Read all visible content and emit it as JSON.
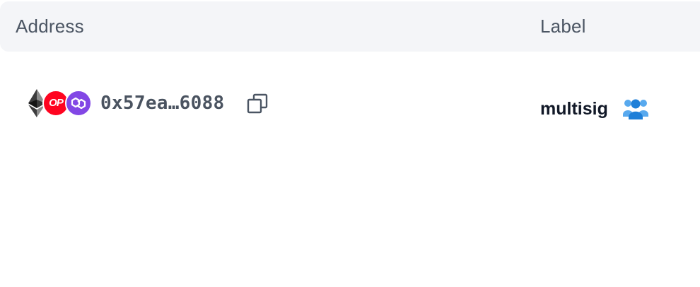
{
  "header": {
    "address_label": "Address",
    "label_label": "Label"
  },
  "rows": [
    {
      "chains": [
        {
          "name": "ethereum-icon",
          "color": "#2b2b2b"
        },
        {
          "name": "optimism-icon",
          "text": "OP",
          "color": "#ff0420"
        },
        {
          "name": "polygon-icon",
          "color": "#8247e5"
        }
      ],
      "address": "0x57ea…6088",
      "copy_icon": "copy-icon",
      "label": "multisig",
      "label_icon": "group-icon",
      "label_icon_color": "#2f8fe5"
    }
  ]
}
